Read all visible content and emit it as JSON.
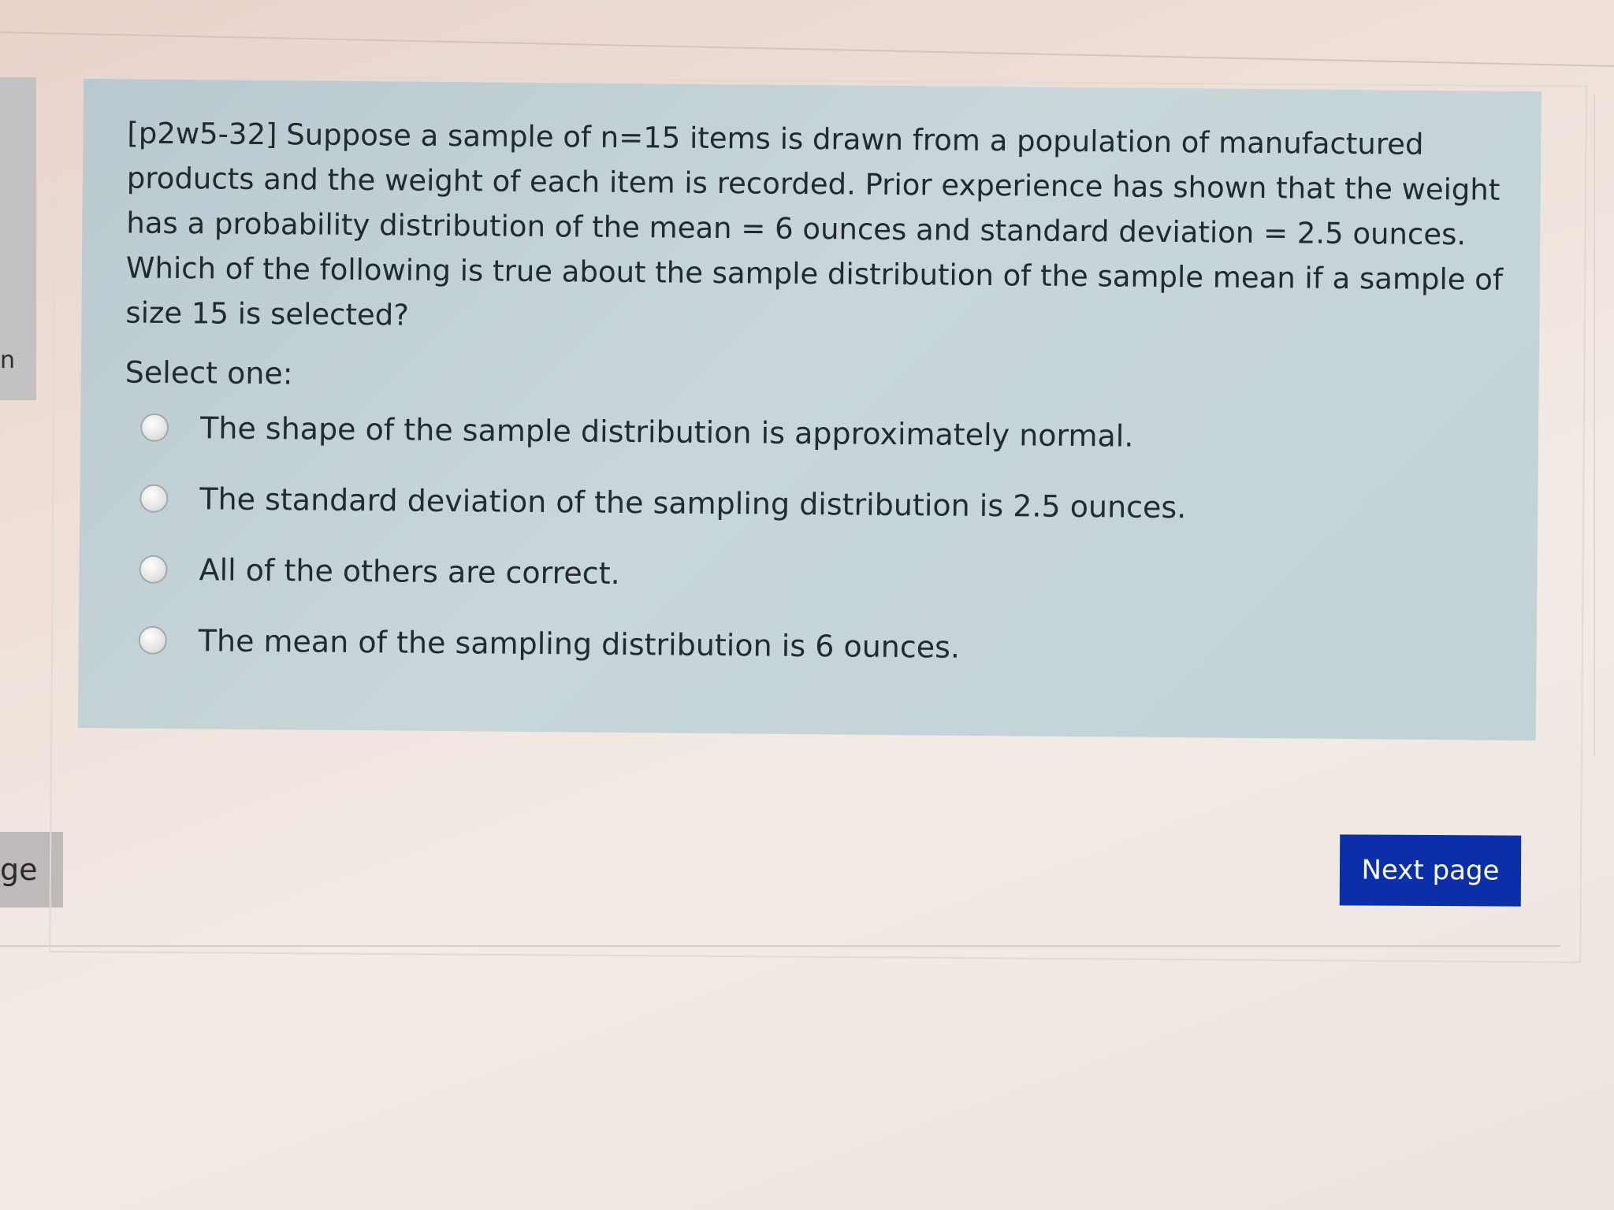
{
  "question": {
    "text": "[p2w5-32] Suppose a sample of n=15 items is drawn from a population of manufactured products and the weight of each item is recorded. Prior experience has shown that the weight has a probability distribution of the mean = 6 ounces and standard deviation = 2.5 ounces. Which of the following is true about the sample distribution of the sample mean if a sample of size 15 is selected?",
    "prompt": "Select one:",
    "options": [
      {
        "label": "The shape of the sample distribution is approximately normal.",
        "selected": false
      },
      {
        "label": "The standard deviation of the sampling distribution is 2.5 ounces.",
        "selected": false
      },
      {
        "label": "All of the others are correct.",
        "selected": false
      },
      {
        "label": "The mean of the sampling distribution is 6 ounces.",
        "selected": false
      }
    ]
  },
  "navigation": {
    "next_label": "Next page",
    "next_color": "#0b2fa8"
  },
  "left_panel": {
    "top_fragment": "n",
    "bottom_fragment": "ge"
  }
}
